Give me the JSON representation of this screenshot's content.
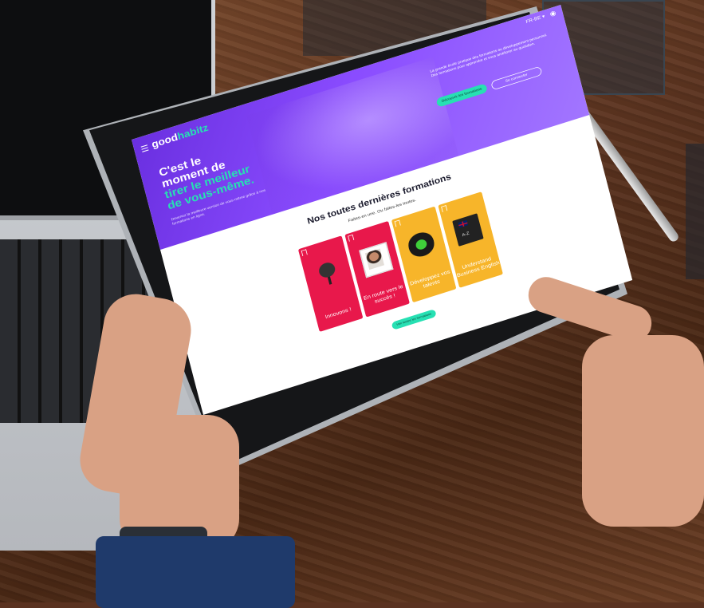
{
  "site": {
    "logo_main": "good",
    "logo_accent": "habitz",
    "lang": "FR-BE ▾",
    "menu_icon": "hamburger-icon",
    "user_icon": "user-icon"
  },
  "hero": {
    "title_line1": "C'est le",
    "title_line2": "moment de",
    "title_line3": "tirer le meilleur",
    "title_line4": "de vous-même.",
    "subtitle": "Devenez la meilleure version de vous-même grâce à nos formations en ligne.",
    "description": "La grande école pratique des formations au développement personnel. Des formations pour apprendre et vous améliorer au quotidien.",
    "btn_primary": "Découvrir les formations",
    "btn_secondary": "Se connecter"
  },
  "section": {
    "title": "Nos toutes dernières formations",
    "subtitle": "Faites-en une. Ou faites-les toutes."
  },
  "cards": [
    {
      "label": "Innovons !",
      "icon": "microphone-icon"
    },
    {
      "label": "En route vers le succès !",
      "icon": "portrait-icon"
    },
    {
      "label": "Développez vos talents",
      "icon": "plant-icon"
    },
    {
      "label": "Understand Business English",
      "icon": "book-icon",
      "book_text": "A-Z"
    }
  ],
  "cta": "Voir toutes les formations",
  "colors": {
    "purple": "#6a2fe0",
    "mint": "#27e0b3",
    "red": "#e8184b",
    "yellow": "#f7b52a"
  }
}
